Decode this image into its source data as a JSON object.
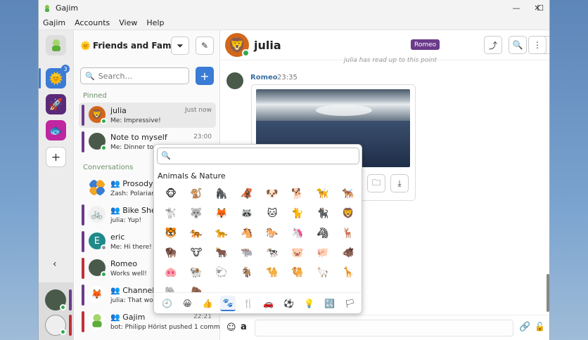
{
  "window": {
    "title": "Gajim"
  },
  "menu": [
    "Gajim",
    "Accounts",
    "View",
    "Help"
  ],
  "workspaces": {
    "badge_count": "3"
  },
  "chat_list": {
    "workspace_name": "Friends and Family",
    "search_placeholder": "Search...",
    "pinned_label": "Pinned",
    "conversations_label": "Conversations",
    "pinned": [
      {
        "name": "julia",
        "preview": "Me: Impressive!",
        "time": "Just now"
      },
      {
        "name": "Note to myself",
        "preview": "Me: Dinner tonight",
        "time": "23:00"
      }
    ],
    "conversations": [
      {
        "name": "Prosody IM",
        "preview": "Zash: Polarian, P",
        "time": ""
      },
      {
        "name": "Bike Shed",
        "preview": "julia: Yup!",
        "time": ""
      },
      {
        "name": "eric",
        "preview": "Me: Hi there!",
        "time": ""
      },
      {
        "name": "Romeo",
        "preview": "Works well!",
        "time": ""
      },
      {
        "name": "Channel",
        "preview": "julia: That would",
        "time": ""
      },
      {
        "name": "Gajim",
        "preview": "bot: Philipp Hörist pushed 1 comm...",
        "time": "22:21"
      }
    ]
  },
  "chat": {
    "contact_name": "julia",
    "nick_tag": "Romeo",
    "read_marker": "julia has read up to this point",
    "message": {
      "sender": "Romeo",
      "time": "23:35"
    }
  },
  "emoji_picker": {
    "category": "Animals & Nature",
    "emojis": [
      "🐵",
      "🐒",
      "🦍",
      "🦧",
      "🐶",
      "🐕",
      "🦮",
      "🐕‍🦺",
      "🐩",
      "🐺",
      "🦊",
      "🦝",
      "🐱",
      "🐈",
      "🐈‍⬛",
      "🦁",
      "🐯",
      "🐅",
      "🐆",
      "🐴",
      "🐎",
      "🦄",
      "🦓",
      "🦌",
      "🦬",
      "🐮",
      "🐂",
      "🐃",
      "🐄",
      "🐷",
      "🐖",
      "🐗",
      "🐽",
      "🐏",
      "🐑",
      "🐐",
      "🐪",
      "🐫",
      "🦙",
      "🦒",
      "🐘",
      "🦣"
    ],
    "tabs": [
      "🕘",
      "😀",
      "👍",
      "🐾",
      "🍴",
      "🚗",
      "⚽",
      "💡",
      "🔣",
      "🏳"
    ]
  }
}
